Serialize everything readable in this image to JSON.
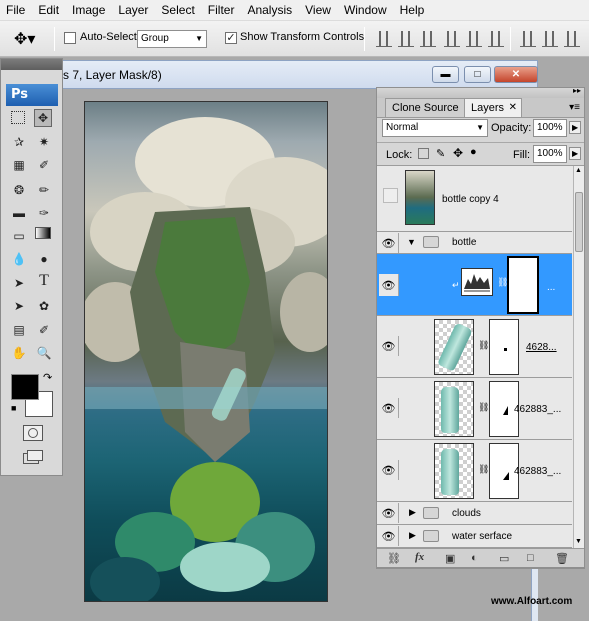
{
  "menu": [
    "File",
    "Edit",
    "Image",
    "Layer",
    "Select",
    "Filter",
    "Analysis",
    "View",
    "Window",
    "Help"
  ],
  "options": {
    "auto_select_label": "Auto-Select:",
    "auto_select_value": "Group",
    "show_transform_label": "Show Transform Controls",
    "show_transform_checked": true,
    "auto_select_checked": false
  },
  "document": {
    "title": "s 7, Layer Mask/8)"
  },
  "tools": {
    "logo": "Ps",
    "text_tool_glyph": "T",
    "icons": [
      "marquee-icon",
      "move-icon",
      "lasso-icon",
      "magic-wand-icon",
      "crop-icon",
      "eyedropper-icon",
      "healing-brush-icon",
      "brush-icon",
      "clone-stamp-icon",
      "history-brush-icon",
      "eraser-icon",
      "gradient-icon",
      "blur-icon",
      "dodge-icon",
      "pen-icon",
      "type-icon",
      "path-selection-icon",
      "shape-icon",
      "notes-icon",
      "eyedropper2-icon",
      "hand-icon",
      "zoom-icon"
    ],
    "foreground_color": "#000000",
    "background_color": "#ffffff"
  },
  "layers_panel": {
    "tabs": [
      "Clone Source",
      "Layers"
    ],
    "active_tab": "Layers",
    "blend_mode": "Normal",
    "opacity_label": "Opacity:",
    "opacity_value": "100%",
    "lock_label": "Lock:",
    "fill_label": "Fill:",
    "fill_value": "100%",
    "layers": [
      {
        "name": "bottle copy 4",
        "visible": false,
        "type": "image"
      },
      {
        "name": "bottle",
        "visible": true,
        "type": "group",
        "expanded": true
      },
      {
        "name": "...",
        "visible": true,
        "type": "adjustment",
        "selected": true
      },
      {
        "name": "4628...",
        "visible": true,
        "type": "masked"
      },
      {
        "name": "462883_...",
        "visible": true,
        "type": "masked"
      },
      {
        "name": "462883_...",
        "visible": true,
        "type": "masked"
      },
      {
        "name": "clouds",
        "visible": true,
        "type": "group",
        "expanded": false
      },
      {
        "name": "water serface",
        "visible": true,
        "type": "group",
        "expanded": false
      }
    ],
    "bottom_icons": [
      "link-icon",
      "fx-icon",
      "mask-icon",
      "adjustment-icon",
      "folder-icon",
      "new-layer-icon",
      "trash-icon"
    ]
  },
  "watermark": "www.Alfoart.com",
  "colors": {
    "accent": "#3399ff",
    "titlebar": "#cfdbee",
    "panel": "#d6d6d6"
  }
}
